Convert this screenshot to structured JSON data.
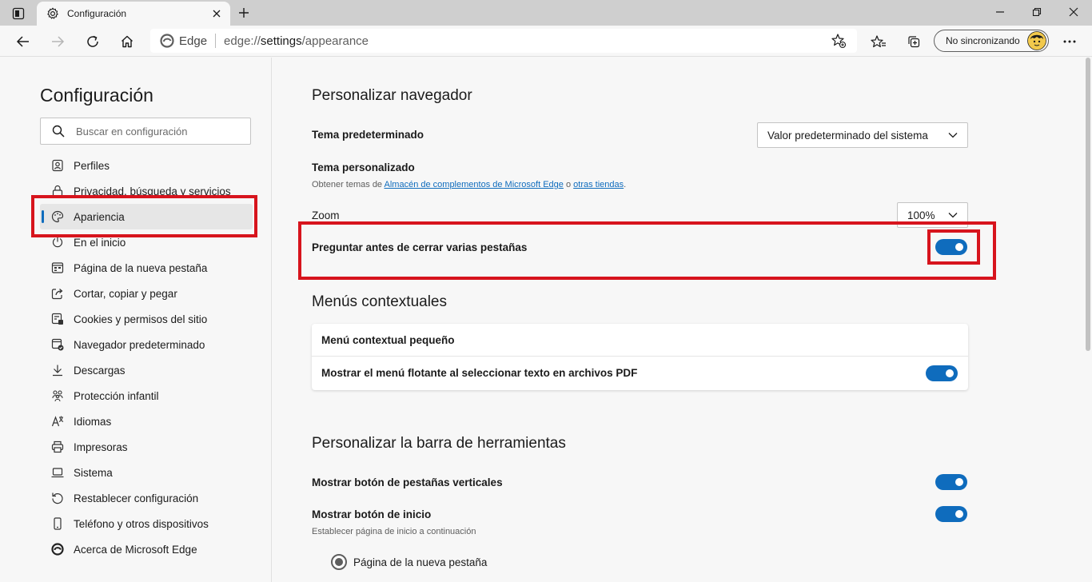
{
  "window": {
    "tab_title": "Configuración",
    "new_tab_glyph": "+",
    "close_glyph": "✕"
  },
  "address_bar": {
    "site_label": "Edge",
    "url_scheme": "edge://",
    "url_path": "settings",
    "url_rest": "/appearance"
  },
  "profile": {
    "label": "No sincronizando"
  },
  "sidebar": {
    "title": "Configuración",
    "search_placeholder": "Buscar en configuración",
    "items": [
      {
        "label": "Perfiles",
        "icon": "profile-icon"
      },
      {
        "label": "Privacidad, búsqueda y servicios",
        "icon": "lock-icon"
      },
      {
        "label": "Apariencia",
        "icon": "palette-icon",
        "active": true
      },
      {
        "label": "En el inicio",
        "icon": "power-icon"
      },
      {
        "label": "Página de la nueva pestaña",
        "icon": "new-tab-page-icon"
      },
      {
        "label": "Cortar, copiar y pegar",
        "icon": "share-icon"
      },
      {
        "label": "Cookies y permisos del sitio",
        "icon": "site-permissions-icon"
      },
      {
        "label": "Navegador predeterminado",
        "icon": "default-browser-icon"
      },
      {
        "label": "Descargas",
        "icon": "download-icon"
      },
      {
        "label": "Protección infantil",
        "icon": "family-icon"
      },
      {
        "label": "Idiomas",
        "icon": "languages-icon"
      },
      {
        "label": "Impresoras",
        "icon": "printer-icon"
      },
      {
        "label": "Sistema",
        "icon": "laptop-icon"
      },
      {
        "label": "Restablecer configuración",
        "icon": "reset-icon"
      },
      {
        "label": "Teléfono y otros dispositivos",
        "icon": "phone-icon"
      },
      {
        "label": "Acerca de Microsoft Edge",
        "icon": "edge-logo-icon"
      }
    ]
  },
  "main": {
    "customize_browser": {
      "heading": "Personalizar navegador",
      "default_theme_label": "Tema predeterminado",
      "default_theme_value": "Valor predeterminado del sistema",
      "custom_theme_label": "Tema personalizado",
      "custom_theme_sub_prefix": "Obtener temas de",
      "custom_theme_link1": "Almacén de complementos de Microsoft Edge",
      "custom_theme_sub_mid": "o",
      "custom_theme_link2": "otras tiendas",
      "custom_theme_sub_suffix": ".",
      "zoom_label": "Zoom",
      "zoom_value": "100%",
      "ask_close_tabs_label": "Preguntar antes de cerrar varias pestañas",
      "ask_close_tabs_on": true
    },
    "context_menus": {
      "heading": "Menús contextuales",
      "small_menu_label": "Menú contextual pequeño",
      "pdf_floating_menu_label": "Mostrar el menú flotante al seleccionar texto en archivos PDF",
      "pdf_floating_menu_on": true
    },
    "toolbar_customize": {
      "heading": "Personalizar la barra de herramientas",
      "vertical_tabs_label": "Mostrar botón de pestañas verticales",
      "vertical_tabs_on": true,
      "home_button_label": "Mostrar botón de inicio",
      "home_button_on": true,
      "home_button_sub": "Establecer página de inicio a continuación",
      "home_option_label": "Página de la nueva pestaña"
    }
  },
  "colors": {
    "accent": "#0f6cbd",
    "highlight": "#d7141d"
  }
}
